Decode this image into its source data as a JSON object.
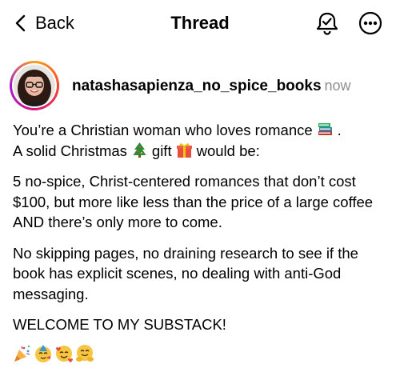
{
  "header": {
    "back_label": "Back",
    "title": "Thread",
    "icons": [
      "chevron-left-icon",
      "notification-bell-icon",
      "more-options-icon"
    ]
  },
  "post": {
    "username": "natashasapienza_no_spice_books",
    "timestamp": "now",
    "p1_a": "You’re a Christian woman who loves romance",
    "p1_b": ".",
    "p1_c": "A solid Christmas",
    "p1_d": "gift",
    "p1_e": "would be:",
    "p2": "5 no-spice, Christ-centered romances that don’t cost $100, but more like less than the price of a large coffee AND there’s only more to come.",
    "p3": "No skipping pages, no draining research to see if the book has explicit scenes, no dealing with anti-God messaging.",
    "p4": "WELCOME TO MY SUBSTACK!",
    "inline_emojis": [
      "books-emoji",
      "christmas-tree-emoji",
      "gift-emoji"
    ],
    "emoji_row": [
      "party-popper-emoji",
      "partying-face-emoji",
      "smiling-face-with-hearts-emoji",
      "hugging-face-emoji"
    ]
  },
  "colors": {
    "text": "#000000",
    "muted": "#8e8e8e",
    "avatar_ring": [
      "#f8a11b",
      "#d2167f",
      "#a01fd0"
    ]
  }
}
